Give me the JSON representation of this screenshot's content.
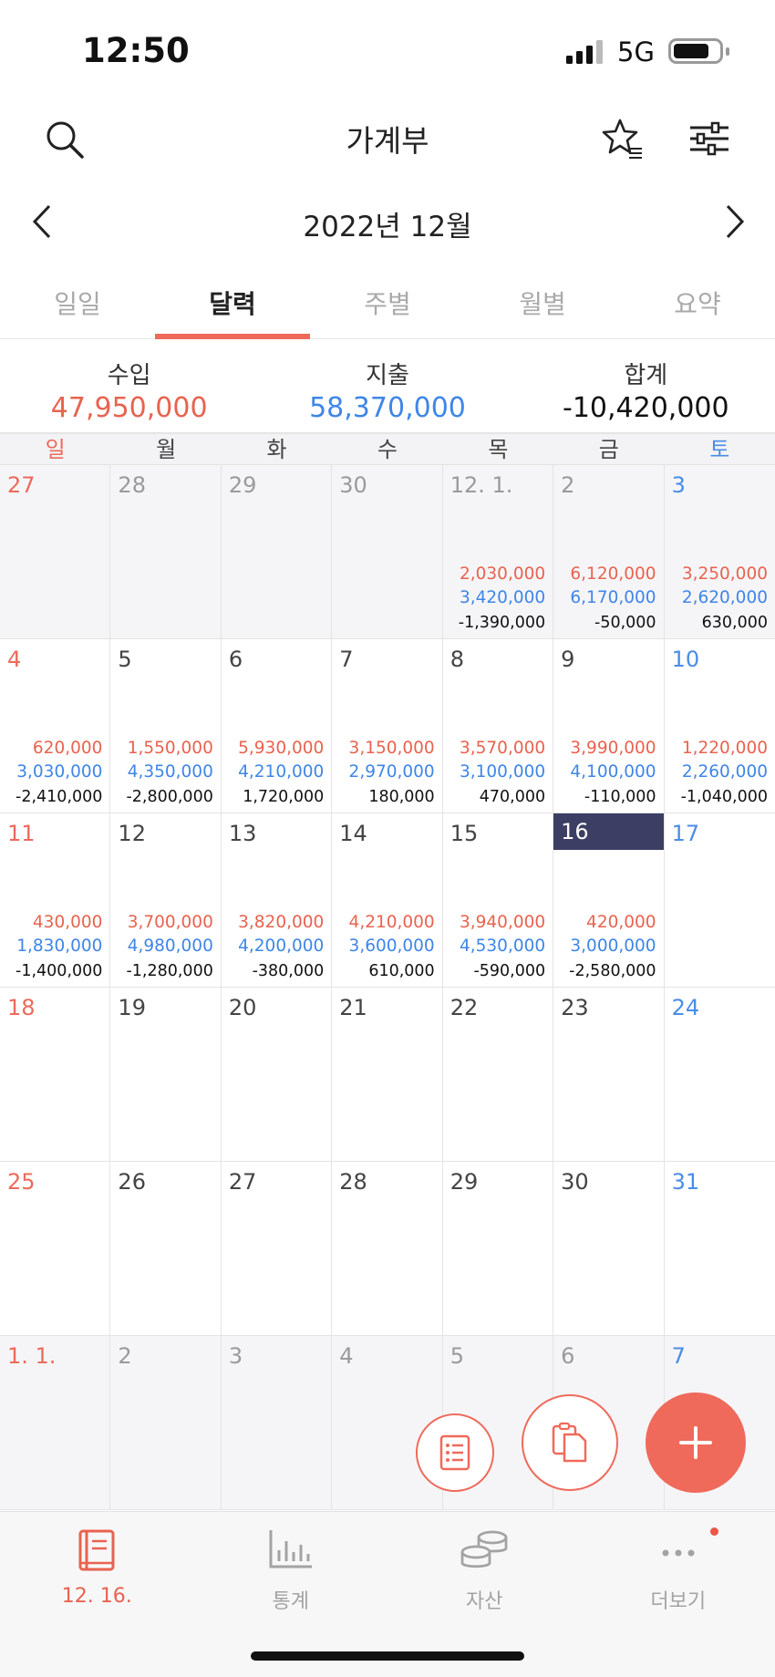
{
  "status": {
    "time": "12:50",
    "network": "5G"
  },
  "header": {
    "title": "가계부"
  },
  "month_nav": {
    "label": "2022년 12월"
  },
  "tabs": [
    {
      "label": "일일",
      "active": false
    },
    {
      "label": "달력",
      "active": true
    },
    {
      "label": "주별",
      "active": false
    },
    {
      "label": "월별",
      "active": false
    },
    {
      "label": "요약",
      "active": false
    }
  ],
  "summary": {
    "income_label": "수입",
    "income": "47,950,000",
    "expense_label": "지출",
    "expense": "58,370,000",
    "total_label": "합계",
    "total": "-10,420,000"
  },
  "weekdays": [
    "일",
    "월",
    "화",
    "수",
    "목",
    "금",
    "토"
  ],
  "calendar": [
    {
      "day": "27",
      "dim": true
    },
    {
      "day": "28",
      "dim": true
    },
    {
      "day": "29",
      "dim": true
    },
    {
      "day": "30",
      "dim": true
    },
    {
      "day": "12. 1.",
      "dim": true,
      "income": "2,030,000",
      "expense": "3,420,000",
      "total": "-1,390,000"
    },
    {
      "day": "2",
      "dim": true,
      "income": "6,120,000",
      "expense": "6,170,000",
      "total": "-50,000"
    },
    {
      "day": "3",
      "dim": true,
      "income": "3,250,000",
      "expense": "2,620,000",
      "total": "630,000"
    },
    {
      "day": "4",
      "income": "620,000",
      "expense": "3,030,000",
      "total": "-2,410,000"
    },
    {
      "day": "5",
      "income": "1,550,000",
      "expense": "4,350,000",
      "total": "-2,800,000"
    },
    {
      "day": "6",
      "income": "5,930,000",
      "expense": "4,210,000",
      "total": "1,720,000"
    },
    {
      "day": "7",
      "income": "3,150,000",
      "expense": "2,970,000",
      "total": "180,000"
    },
    {
      "day": "8",
      "income": "3,570,000",
      "expense": "3,100,000",
      "total": "470,000"
    },
    {
      "day": "9",
      "income": "3,990,000",
      "expense": "4,100,000",
      "total": "-110,000"
    },
    {
      "day": "10",
      "income": "1,220,000",
      "expense": "2,260,000",
      "total": "-1,040,000"
    },
    {
      "day": "11",
      "income": "430,000",
      "expense": "1,830,000",
      "total": "-1,400,000"
    },
    {
      "day": "12",
      "income": "3,700,000",
      "expense": "4,980,000",
      "total": "-1,280,000"
    },
    {
      "day": "13",
      "income": "3,820,000",
      "expense": "4,200,000",
      "total": "-380,000"
    },
    {
      "day": "14",
      "income": "4,210,000",
      "expense": "3,600,000",
      "total": "610,000"
    },
    {
      "day": "15",
      "income": "3,940,000",
      "expense": "4,530,000",
      "total": "-590,000"
    },
    {
      "day": "16",
      "today": true,
      "income": "420,000",
      "expense": "3,000,000",
      "total": "-2,580,000"
    },
    {
      "day": "17"
    },
    {
      "day": "18"
    },
    {
      "day": "19"
    },
    {
      "day": "20"
    },
    {
      "day": "21"
    },
    {
      "day": "22"
    },
    {
      "day": "23"
    },
    {
      "day": "24"
    },
    {
      "day": "25"
    },
    {
      "day": "26"
    },
    {
      "day": "27"
    },
    {
      "day": "28"
    },
    {
      "day": "29"
    },
    {
      "day": "30"
    },
    {
      "day": "31"
    },
    {
      "day": "1. 1.",
      "dim": true
    },
    {
      "day": "2",
      "dim": true
    },
    {
      "day": "3",
      "dim": true
    },
    {
      "day": "4",
      "dim": true
    },
    {
      "day": "5",
      "dim": true
    },
    {
      "day": "6",
      "dim": true
    },
    {
      "day": "7",
      "dim": true
    }
  ],
  "bottom_nav": [
    {
      "label": "12. 16.",
      "icon": "book-icon",
      "active": true
    },
    {
      "label": "통계",
      "icon": "bar-chart-icon",
      "active": false
    },
    {
      "label": "자산",
      "icon": "coins-icon",
      "active": false
    },
    {
      "label": "더보기",
      "icon": "more-dots-icon",
      "active": false,
      "badge": true
    }
  ],
  "colors": {
    "accent": "#ef6a5b",
    "income": "#e8634f",
    "expense": "#3f86e6",
    "today": "#3c3f63"
  }
}
